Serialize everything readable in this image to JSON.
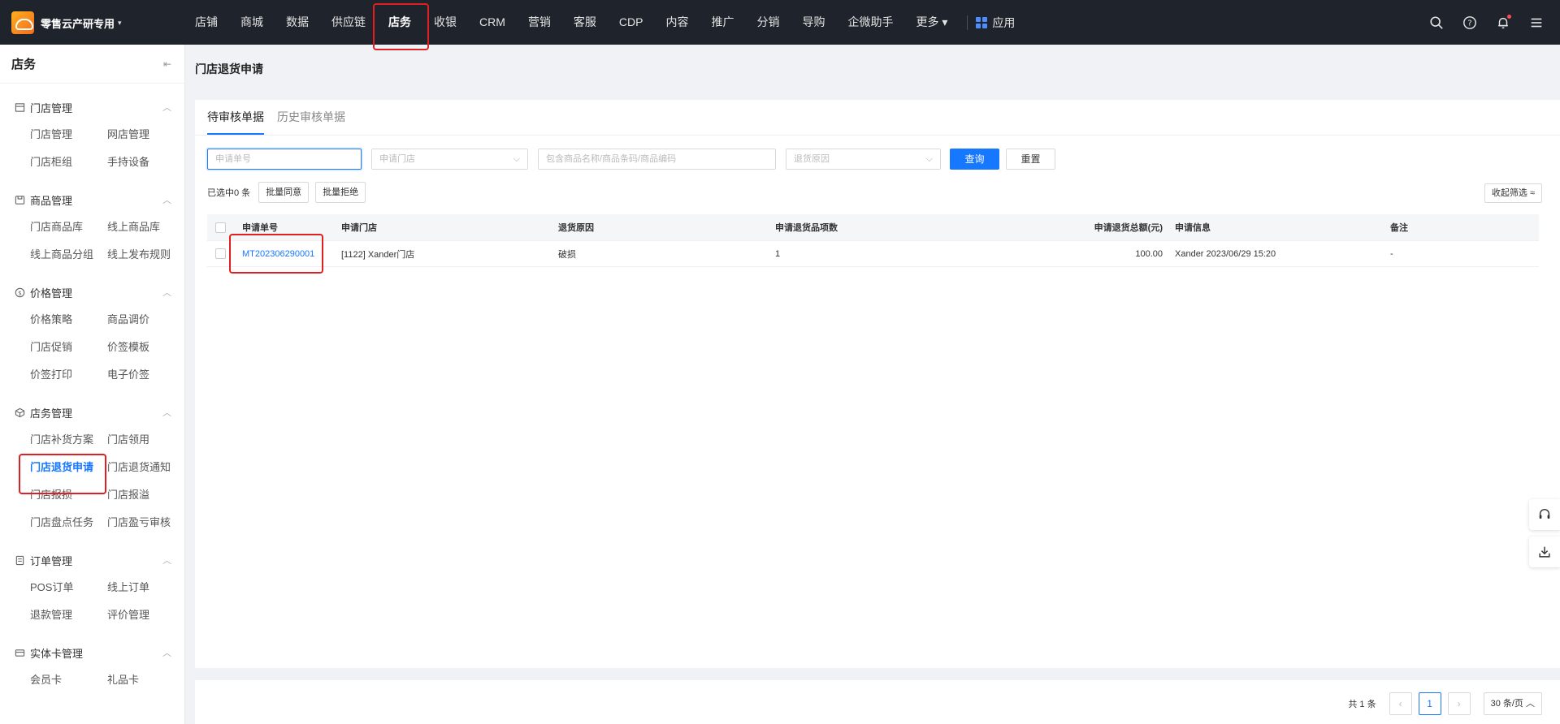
{
  "brand": {
    "name": "零售云产研专用",
    "caret": "▾"
  },
  "nav": {
    "items": [
      "店铺",
      "商城",
      "数据",
      "供应链",
      "店务",
      "收银",
      "CRM",
      "营销",
      "客服",
      "CDP",
      "内容",
      "推广",
      "分销",
      "导购",
      "企微助手",
      "更多 ▾"
    ],
    "active_index": 4,
    "apps_label": "应用"
  },
  "sidebar": {
    "title": "店务",
    "groups": [
      {
        "title": "门店管理",
        "icon": "store-icon",
        "items": [
          "门店管理",
          "网店管理",
          "门店柜组",
          "手持设备"
        ]
      },
      {
        "title": "商品管理",
        "icon": "goods-icon",
        "items": [
          "门店商品库",
          "线上商品库",
          "线上商品分组",
          "线上发布规则"
        ]
      },
      {
        "title": "价格管理",
        "icon": "price-icon",
        "items": [
          "价格策略",
          "商品调价",
          "门店促销",
          "价签模板",
          "价签打印",
          "电子价签"
        ]
      },
      {
        "title": "店务管理",
        "icon": "shop-ops-icon",
        "items": [
          "门店补货方案",
          "门店领用",
          "门店退货申请",
          "门店退货通知",
          "门店报损",
          "门店报溢",
          "门店盘点任务",
          "门店盈亏审核"
        ]
      },
      {
        "title": "订单管理",
        "icon": "order-icon",
        "items": [
          "POS订单",
          "线上订单",
          "退款管理",
          "评价管理"
        ]
      },
      {
        "title": "实体卡管理",
        "icon": "card-icon",
        "items": [
          "会员卡",
          "礼品卡"
        ]
      }
    ],
    "active_item": "门店退货申请"
  },
  "page": {
    "title": "门店退货申请",
    "tabs": [
      "待审核单据",
      "历史审核单据"
    ],
    "filters": {
      "order_no_placeholder": "申请单号",
      "store_placeholder": "申请门店",
      "goods_placeholder": "包含商品名称/商品条码/商品编码",
      "reason_placeholder": "退货原因",
      "query_label": "查询",
      "reset_label": "重置"
    },
    "ops": {
      "selected": "已选中0 条",
      "batch_agree": "批量同意",
      "batch_reject": "批量拒绝",
      "collapse_filter": "收起筛选 ≈"
    },
    "table": {
      "columns": [
        "申请单号",
        "申请门店",
        "退货原因",
        "申请退货品项数",
        "申请退货总额(元)",
        "申请信息",
        "备注"
      ],
      "rows": [
        {
          "order_no": "MT202306290001",
          "store": "[1122] Xander门店",
          "reason": "破损",
          "items": "1",
          "amount": "100.00",
          "info": "Xander 2023/06/29 15:20",
          "remark": "-"
        }
      ]
    },
    "pagination": {
      "total": "共 1 条",
      "current": "1",
      "size": "30 条/页",
      "prev": "‹",
      "next": "›"
    }
  }
}
